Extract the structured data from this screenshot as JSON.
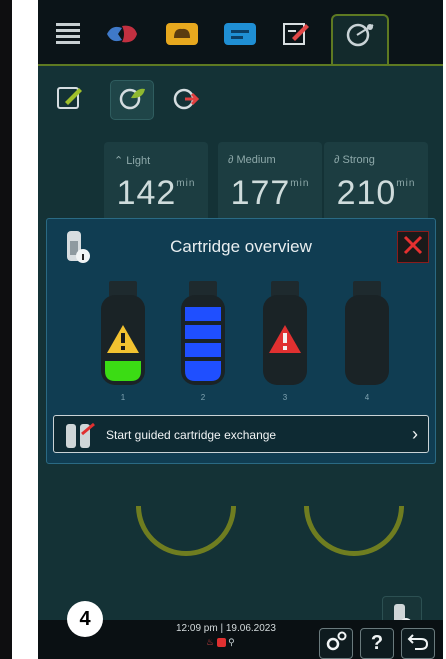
{
  "nav": {
    "items": [
      {
        "icon": "menu-lines-icon"
      },
      {
        "icon": "meat-fish-icon"
      },
      {
        "icon": "bakery-icon"
      },
      {
        "icon": "side-dish-icon"
      },
      {
        "icon": "edit-notes-icon"
      },
      {
        "icon": "smoker-icon"
      }
    ],
    "active_index": 5
  },
  "subtabs": [
    {
      "icon": "edit-program-icon"
    },
    {
      "icon": "smoke-leaf-icon"
    },
    {
      "icon": "smoke-arrow-icon"
    }
  ],
  "intensity": [
    {
      "label": "Light",
      "value": "142",
      "unit": "min"
    },
    {
      "label": "Medium",
      "value": "177",
      "unit": "min"
    },
    {
      "label": "Strong",
      "value": "210",
      "unit": "min"
    }
  ],
  "modal": {
    "title": "Cartridge overview",
    "slots": [
      {
        "number": "1",
        "status": "warning-low",
        "fill_fraction": 0.2
      },
      {
        "number": "2",
        "status": "full",
        "fill_fraction": 1.0
      },
      {
        "number": "3",
        "status": "error",
        "fill_fraction": 0.0
      },
      {
        "number": "4",
        "status": "empty",
        "fill_fraction": 0.0
      }
    ],
    "exchange_label": "Start guided cartridge exchange"
  },
  "statusbar": {
    "time": "12:09 pm",
    "separator": "|",
    "date": "19.06.2023"
  },
  "step_badge": "4",
  "colors": {
    "accent_green": "#5e7a22",
    "alert_red": "#e03030",
    "warning_yellow": "#f2c230",
    "cartridge_blue": "#1f4fff",
    "cartridge_green": "#3bdc14"
  }
}
